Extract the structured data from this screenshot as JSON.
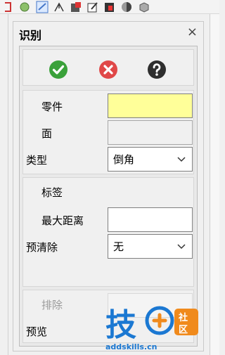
{
  "panel": {
    "title": "识别",
    "close_glyph": "×"
  },
  "actions": {
    "ok_icon": "check-circle-icon",
    "cancel_icon": "x-circle-icon",
    "help_icon": "question-circle-icon",
    "ok_color": "#3aa13a",
    "cancel_color": "#e04848",
    "help_color": "#2e2e2e"
  },
  "selection": {
    "part_label": "零件",
    "part_value": "",
    "face_label": "面",
    "face_value": "",
    "type_label": "类型",
    "type_value": "倒角"
  },
  "label_section": {
    "heading": "标签",
    "max_distance_label": "最大距离",
    "max_distance_value": "",
    "pre_clear_label": "预清除",
    "pre_clear_value": "无"
  },
  "exclude_section": {
    "exclude_label": "排除",
    "exclude_value": "",
    "preview_label": "预览"
  },
  "watermark": {
    "char": "技",
    "badge_left": "社",
    "badge_right": "区",
    "site": "addskills.cn",
    "color": "#1b78d2",
    "accent": "#f08a1c"
  },
  "colors": {
    "highlight_field": "#ffff99"
  }
}
